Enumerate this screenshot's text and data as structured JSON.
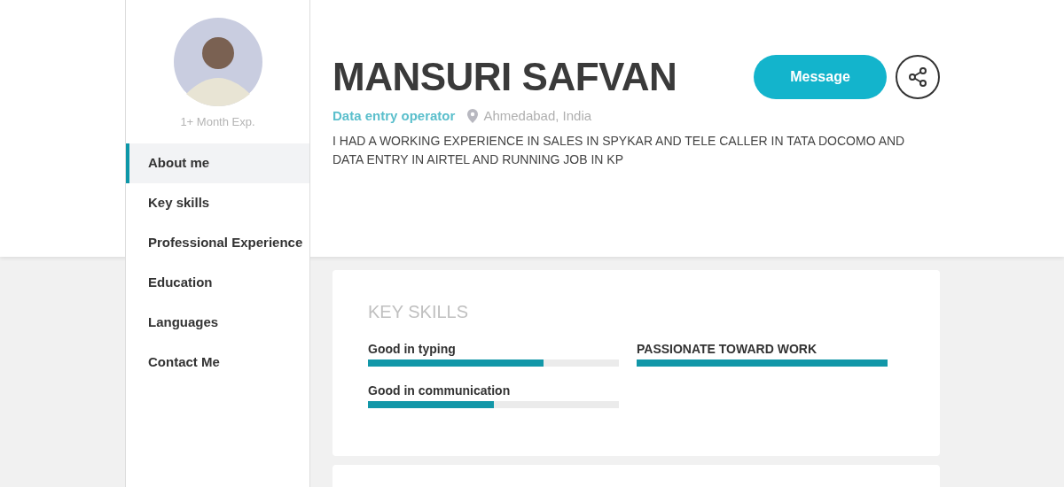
{
  "profile": {
    "experience": "1+ Month Exp.",
    "name": "MANSURI SAFVAN",
    "role": "Data entry operator",
    "location": "Ahmedabad, India",
    "summary": "I HAD A WORKING EXPERIENCE IN SALES IN SPYKAR AND TELE CALLER IN TATA DOCOMO AND DATA ENTRY IN AIRTEL AND RUNNING JOB IN KP"
  },
  "actions": {
    "message": "Message"
  },
  "sidebar": {
    "items": [
      {
        "label": "About me",
        "selected": true
      },
      {
        "label": "Key skills",
        "selected": false
      },
      {
        "label": "Professional Experience",
        "selected": false
      },
      {
        "label": "Education",
        "selected": false
      },
      {
        "label": "Languages",
        "selected": false
      },
      {
        "label": "Contact Me",
        "selected": false
      }
    ]
  },
  "key_skills": {
    "title": "KEY SKILLS",
    "skills": [
      {
        "name": "Good in typing",
        "level": 0.7
      },
      {
        "name": "PASSIONATE TOWARD WORK",
        "level": 1
      },
      {
        "name": "Good in communication",
        "level": 0.5
      }
    ]
  }
}
